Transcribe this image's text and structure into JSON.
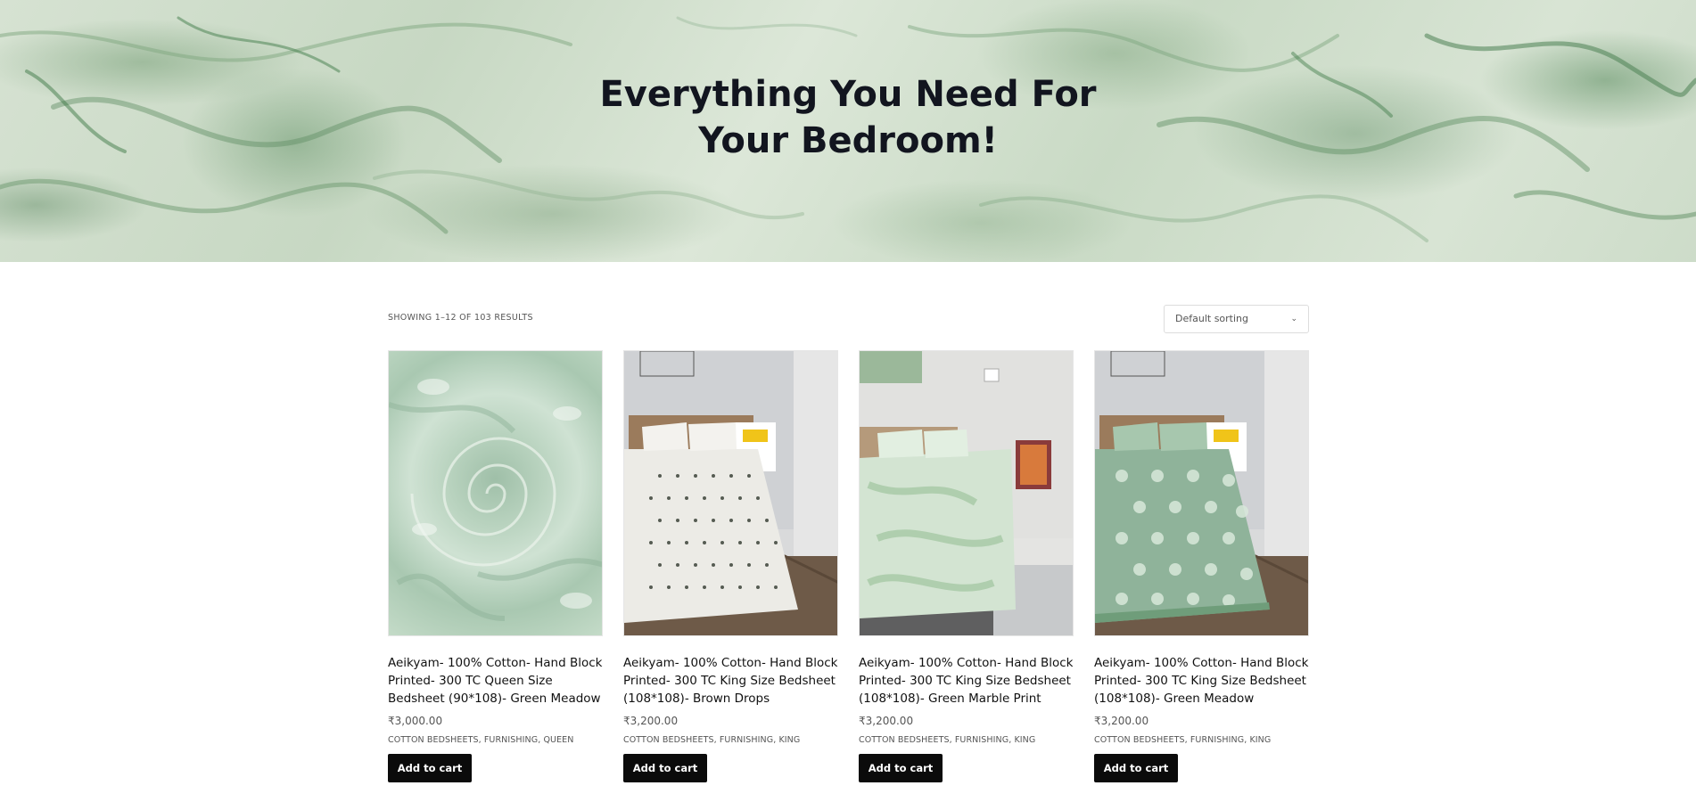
{
  "hero": {
    "title_line1": "Everything You Need For",
    "title_line2": "Your Bedroom!"
  },
  "shop": {
    "result_count": "Showing 1–12 of 103 results",
    "sort": {
      "selected": "Default sorting",
      "icon": "chevron-down-icon"
    }
  },
  "products": [
    {
      "title": "Aeikyam- 100% Cotton- Hand Block Printed- 300 TC Queen Size Bedsheet (90*108)- Green Meadow",
      "price": "₹3,000.00",
      "categories": "Cotton Bedsheets, Furnishing, Queen",
      "button": "Add to cart",
      "image": "green-floral-fabric-swirl"
    },
    {
      "title": "Aeikyam- 100% Cotton- Hand Block Printed- 300 TC King Size Bedsheet (108*108)- Brown Drops",
      "price": "₹3,200.00",
      "categories": "Cotton Bedsheets, Furnishing, King",
      "button": "Add to cart",
      "image": "bed-with-brown-drops-bedsheet"
    },
    {
      "title": "Aeikyam- 100% Cotton- Hand Block Printed- 300 TC King Size Bedsheet (108*108)- Green Marble Print",
      "price": "₹3,200.00",
      "categories": "Cotton Bedsheets, Furnishing, King",
      "button": "Add to cart",
      "image": "bed-with-green-marble-bedsheet"
    },
    {
      "title": "Aeikyam- 100% Cotton- Hand Block Printed- 300 TC King Size Bedsheet (108*108)- Green Meadow",
      "price": "₹3,200.00",
      "categories": "Cotton Bedsheets, Furnishing, King",
      "button": "Add to cart",
      "image": "bed-with-green-meadow-bedsheet"
    }
  ],
  "colors": {
    "button_bg": "#0b0b0b",
    "hero_title": "#12151f",
    "hero_green": "#c9dac5"
  }
}
